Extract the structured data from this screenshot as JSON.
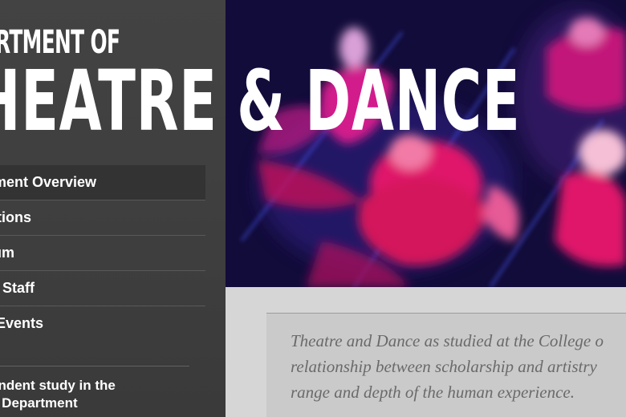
{
  "header": {
    "title_line1": "RTMENT OF",
    "title_line2": "HEATRE & DANCE"
  },
  "nav": {
    "items": [
      {
        "label": "tment Overview"
      },
      {
        "label": "ctions"
      },
      {
        "label": "ulum"
      },
      {
        "label": "y & Staff"
      },
      {
        "label": "& Events"
      }
    ]
  },
  "promo": {
    "line1": "endent study in the",
    "line2": "e Department"
  },
  "hero": {
    "image_description": "dancers-motion-blur-photo"
  },
  "intro": {
    "line1": "Theatre and Dance as studied at the College o",
    "line2": "relationship between scholarship and artistry",
    "line3": "range and depth of the human experience."
  },
  "colors": {
    "sidebar_bg": "#424242",
    "text_white": "#ffffff",
    "content_bg": "#d6d6d6",
    "quote_text": "#6a6a6a",
    "hero_magenta": "#e0186a",
    "hero_blue": "#1a1450"
  }
}
